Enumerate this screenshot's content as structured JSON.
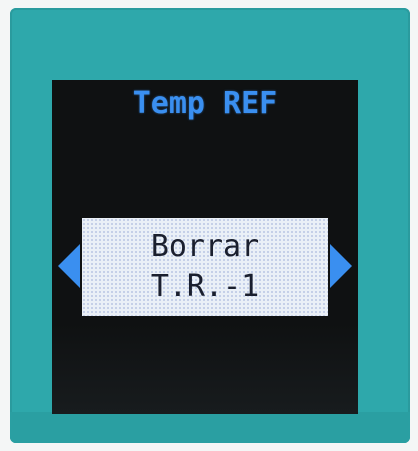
{
  "screen": {
    "title": "Temp REF",
    "option": {
      "line1": "Borrar",
      "line2": "T.R.-1"
    },
    "prev_icon": "left-triangle-icon",
    "next_icon": "right-triangle-icon"
  },
  "colors": {
    "bezel": "#2ea8ab",
    "screen_bg": "#0f1112",
    "accent": "#3a8ff0",
    "option_bg": "#eaf0f7",
    "option_text": "#1a1f2e"
  }
}
